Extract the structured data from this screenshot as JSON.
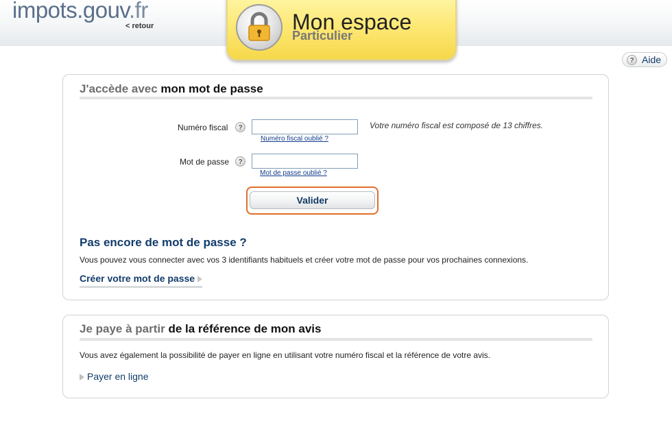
{
  "header": {
    "logo_main": "impots.gouv",
    "logo_suffix": ".fr",
    "back_link": "< retour",
    "space_title": "Mon espace",
    "space_subtitle": "Particulier",
    "help_button": "Aide",
    "help_icon_glyph": "?"
  },
  "login_panel": {
    "title_light": "J'accède avec ",
    "title_dark": "mon mot de passe",
    "tax_number_label": "Numéro fiscal",
    "tax_number_value": "",
    "tax_number_hint": "Votre numéro fiscal est composé de 13 chiffres.",
    "tax_number_forgot": "Numéro fiscal oublié ?",
    "password_label": "Mot de passe",
    "password_value": "",
    "password_forgot": "Mot de passe oublié ?",
    "help_glyph": "?",
    "submit_label": "Valider",
    "no_password_heading": "Pas encore de mot de passe ?",
    "no_password_text": "Vous pouvez vous connecter avec vos 3 identifiants habituels et créer votre mot de passe pour vos prochaines connexions.",
    "create_password_link": "Créer votre mot de passe"
  },
  "payment_panel": {
    "title_light": "Je paye à partir ",
    "title_dark": "de la référence de mon avis",
    "text": "Vous avez également la possibilité de payer en ligne en utilisant votre numéro fiscal et la référence de votre avis.",
    "pay_link": "Payer en ligne"
  },
  "colors": {
    "accent_blue": "#123c6b",
    "highlight_orange": "#e06e2a",
    "badge_yellow": "#fde978"
  },
  "icons": {
    "lock": "padlock-icon",
    "help": "question-mark-icon",
    "arrow": "triangle-right-icon"
  }
}
